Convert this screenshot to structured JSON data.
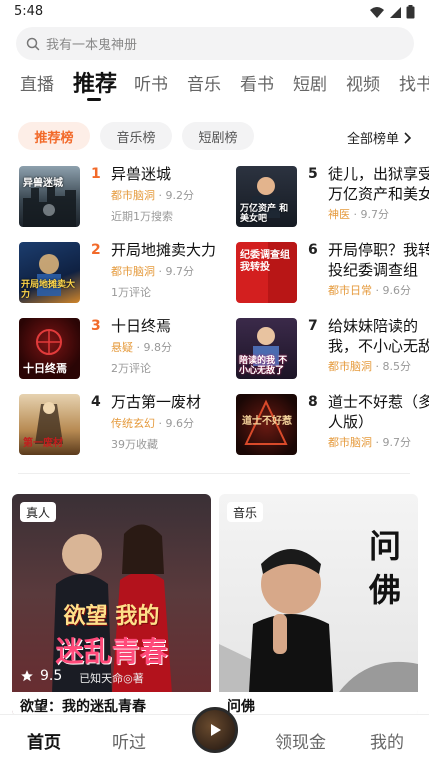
{
  "status": {
    "time": "5:48"
  },
  "search": {
    "placeholder": "我有一本鬼神册"
  },
  "tabs": [
    {
      "label": "直播"
    },
    {
      "label": "推荐"
    },
    {
      "label": "听书"
    },
    {
      "label": "音乐"
    },
    {
      "label": "看书"
    },
    {
      "label": "短剧"
    },
    {
      "label": "视频"
    },
    {
      "label": "找书"
    }
  ],
  "chips": [
    {
      "label": "推荐榜"
    },
    {
      "label": "音乐榜"
    },
    {
      "label": "短剧榜"
    }
  ],
  "all_charts": "全部榜单",
  "rankings": [
    {
      "rank": "1",
      "title": "异兽迷城",
      "genre": "都市脑洞",
      "score": "9.2分",
      "extra": "近期1万搜索",
      "cover_text": "异兽迷城"
    },
    {
      "rank": "2",
      "title": "开局地摊卖大力",
      "genre": "都市脑洞",
      "score": "9.7分",
      "extra": "1万评论",
      "cover_text": "开局地摊卖大力"
    },
    {
      "rank": "3",
      "title": "十日终焉",
      "genre": "悬疑",
      "score": "9.8分",
      "extra": "2万评论",
      "cover_text": "十日终焉"
    },
    {
      "rank": "4",
      "title": "万古第一废材",
      "genre": "传统玄幻",
      "score": "9.6分",
      "extra": "39万收藏",
      "cover_text": "第一废材"
    },
    {
      "rank": "5",
      "title": "徒儿，出狱享受万亿资产和美女",
      "genre": "神医",
      "score": "9.7分",
      "extra": "",
      "cover_text": "万亿资产 和美女吧"
    },
    {
      "rank": "6",
      "title": "开局停职？我转投纪委调查组",
      "genre": "都市日常",
      "score": "9.6分",
      "extra": "",
      "cover_text": "纪委调查组 我转投"
    },
    {
      "rank": "7",
      "title": "给妹妹陪读的我，不小心无敌了",
      "genre": "都市脑洞",
      "score": "8.5分",
      "extra": "",
      "cover_text": "陪读的我 不小心无敌了"
    },
    {
      "rank": "8",
      "title": "道士不好惹（多人版）",
      "genre": "都市脑洞",
      "score": "9.7分",
      "extra": "",
      "cover_text": "道士不好惹"
    }
  ],
  "cards": [
    {
      "badge": "真人",
      "title": "欲望：我的迷乱青春",
      "rating": "9.5",
      "cover_line1": "欲望 我的",
      "cover_line2": "迷乱青春",
      "cover_author": "已知天命◎著"
    },
    {
      "badge": "音乐",
      "title": "问佛",
      "cover_text": "问佛"
    }
  ],
  "bottom_nav": [
    {
      "label": "首页"
    },
    {
      "label": "听过"
    },
    {
      "label": "领现金"
    },
    {
      "label": "我的"
    }
  ],
  "colors": {
    "accent": "#f26a2a",
    "genre": "#e59a3c",
    "rank_gray": "#222222"
  }
}
